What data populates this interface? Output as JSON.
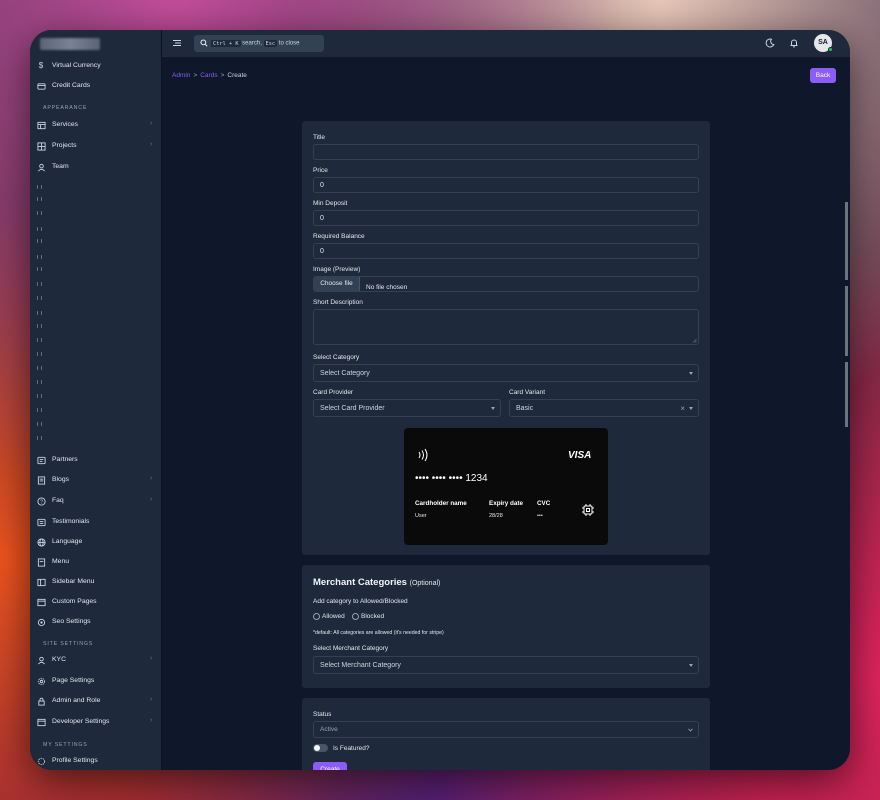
{
  "sidebar": {
    "items_top": [
      {
        "label": "Virtual Currency",
        "icon": "dollar-icon",
        "chevron": false
      },
      {
        "label": "Credit Cards",
        "icon": "card-icon",
        "chevron": false
      }
    ],
    "section_appearance": "APPEARANCE",
    "items_appearance": [
      {
        "label": "Services",
        "icon": "table-icon",
        "chevron": true
      },
      {
        "label": "Projects",
        "icon": "grid-icon",
        "chevron": true
      },
      {
        "label": "Team",
        "icon": "user-icon",
        "chevron": false
      }
    ],
    "items_mid": [
      {
        "label": "Partners",
        "icon": "partners-icon",
        "chevron": false
      },
      {
        "label": "Blogs",
        "icon": "blog-icon",
        "chevron": true
      },
      {
        "label": "Faq",
        "icon": "help-icon",
        "chevron": true
      },
      {
        "label": "Testimonials",
        "icon": "quote-icon",
        "chevron": false
      },
      {
        "label": "Language",
        "icon": "globe-icon",
        "chevron": false
      },
      {
        "label": "Menu",
        "icon": "menu-icon",
        "chevron": false
      },
      {
        "label": "Sidebar Menu",
        "icon": "layout-icon",
        "chevron": false
      },
      {
        "label": "Custom Pages",
        "icon": "page-icon",
        "chevron": false
      },
      {
        "label": "Seo Settings",
        "icon": "seo-icon",
        "chevron": false
      }
    ],
    "section_site": "SITE SETTINGS",
    "items_site": [
      {
        "label": "KYC",
        "icon": "kyc-icon",
        "chevron": true
      },
      {
        "label": "Page Settings",
        "icon": "gear-icon",
        "chevron": false
      },
      {
        "label": "Admin and Role",
        "icon": "lock-icon",
        "chevron": true
      },
      {
        "label": "Developer Settings",
        "icon": "code-icon",
        "chevron": true
      }
    ],
    "section_my": "MY SETTINGS",
    "items_my": [
      {
        "label": "Profile Settings",
        "icon": "profile-icon",
        "chevron": false
      }
    ]
  },
  "topbar": {
    "search_key1": "Ctrl + K",
    "search_mid": " search, ",
    "search_key2": "Esc",
    "search_end": " to close",
    "avatar": "SA"
  },
  "breadcrumb": {
    "a": "Admin",
    "b": "Cards",
    "c": "Create",
    "sep": ">"
  },
  "back_label": "Back",
  "form": {
    "title_label": "Title",
    "title_value": "",
    "price_label": "Price",
    "price_value": "0",
    "min_deposit_label": "Min Deposit",
    "min_deposit_value": "0",
    "required_balance_label": "Required Balance",
    "required_balance_value": "0",
    "image_label": "Image (Preview)",
    "choose_file": "Choose file",
    "no_file": "No file chosen",
    "short_desc_label": "Short Description",
    "category_label": "Select Category",
    "category_value": "Select Category",
    "provider_label": "Card Provider",
    "provider_value": "Select Card Provider",
    "variant_label": "Card Variant",
    "variant_value": "Basic",
    "clear_glyph": "×"
  },
  "card_preview": {
    "brand": "VISA",
    "number": "•••• •••• •••• 1234",
    "holder_label": "Cardholder name",
    "holder_value": "User",
    "expiry_label": "Expiry date",
    "expiry_value": "28/28",
    "cvc_label": "CVC",
    "cvc_value": "•••"
  },
  "merchant": {
    "title": "Merchant Categories",
    "optional": "(Optional)",
    "add_label": "Add category to Allowed/Blocked",
    "allowed": "Allowed",
    "blocked": "Blocked",
    "note": "*default: All categories are allowed (it's needed for stripe)",
    "select_label": "Select Merchant Category",
    "select_value": "Select Merchant Category"
  },
  "status": {
    "label": "Status",
    "value": "Active",
    "featured_label": "Is Featured?",
    "create_label": "Create"
  },
  "colors": {
    "accent": "#8b5cf6",
    "panel": "#1e293b",
    "bg": "#0f172a"
  }
}
